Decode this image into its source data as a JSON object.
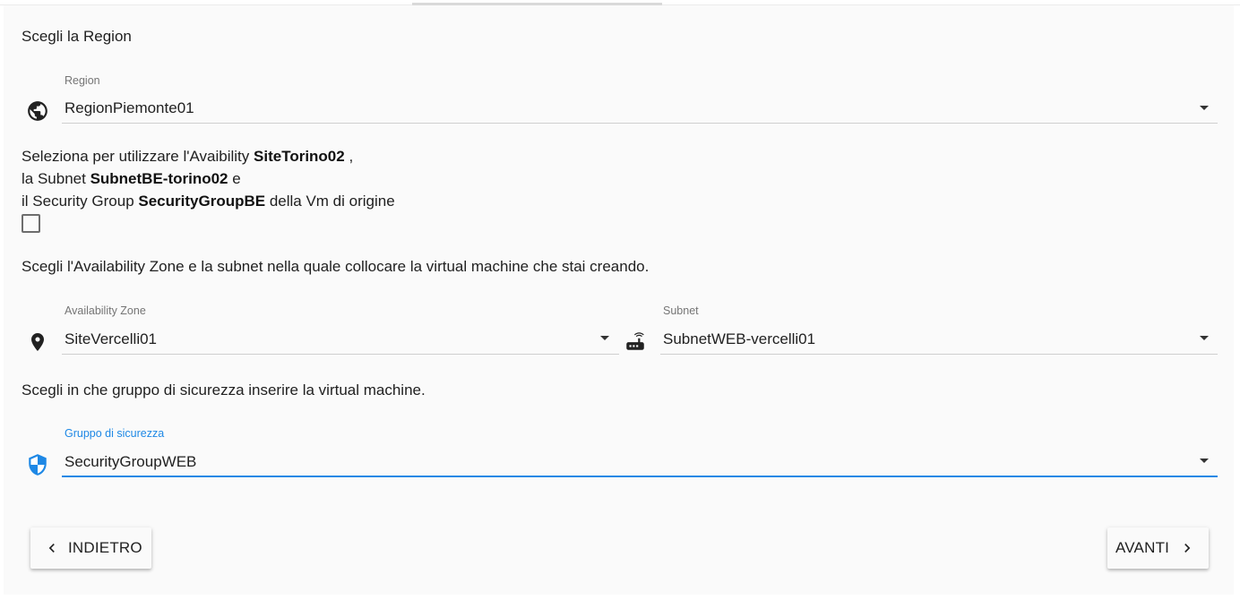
{
  "region_section": {
    "heading": "Scegli la Region",
    "field_label": "Region",
    "value": "RegionPiemonte01",
    "icon": "globe-icon"
  },
  "reuse_section": {
    "line1_prefix": "Seleziona per utilizzare l'Avaibility ",
    "line1_site": "SiteTorino02",
    "line1_suffix": " ,",
    "line2_prefix": "la Subnet ",
    "line2_subnet": "SubnetBE-torino02",
    "line2_suffix": " e",
    "line3_prefix": "il Security Group ",
    "line3_group": "SecurityGroupBE",
    "line3_suffix": " della Vm di origine",
    "checkbox_checked": false
  },
  "placement_section": {
    "heading": "Scegli l'Availability Zone e la subnet nella quale collocare la virtual machine che stai creando.",
    "az_label": "Availability Zone",
    "az_value": "SiteVercelli01",
    "az_icon": "location-pin-icon",
    "subnet_label": "Subnet",
    "subnet_value": "SubnetWEB-vercelli01",
    "subnet_icon": "router-icon"
  },
  "security_section": {
    "heading": "Scegli in che gruppo di sicurezza inserire la virtual machine.",
    "field_label": "Gruppo di sicurezza",
    "value": "SecurityGroupWEB",
    "icon": "security-shield-icon"
  },
  "nav": {
    "back_label": "INDIETRO",
    "next_label": "AVANTI"
  },
  "colors": {
    "accent": "#1e88e5",
    "text": "#212121",
    "label": "#757575"
  }
}
